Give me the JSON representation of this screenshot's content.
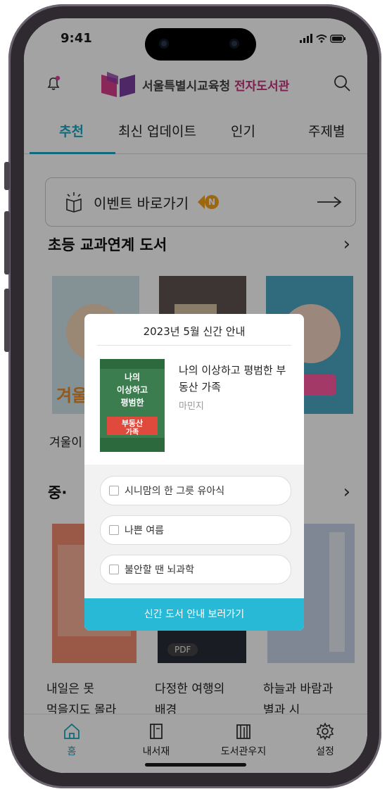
{
  "status": {
    "time": "9:41"
  },
  "header": {
    "title_main": "서울특별시교육청 ",
    "title_accent": "전자도서관"
  },
  "tabs": [
    {
      "label": "추천",
      "active": true
    },
    {
      "label": "최신 업데이트",
      "active": false
    },
    {
      "label": "인기",
      "active": false
    },
    {
      "label": "주제별",
      "active": false
    }
  ],
  "event": {
    "label": "이벤트 바로가기",
    "badge": "N"
  },
  "sections": {
    "elementary": "초등 교과연계 도서",
    "middle": "중·"
  },
  "books_row1": [
    {
      "caption": "겨울이"
    }
  ],
  "books_row2": [
    {
      "caption_line1": "내일은 못",
      "caption_line2": "먹을지도 몰라"
    },
    {
      "caption_line1": "다정한 여행의",
      "caption_line2": "배경",
      "badge": "PDF"
    },
    {
      "caption_line1": "하늘과 바람과",
      "caption_line2": "별과 시"
    }
  ],
  "modal": {
    "title": "2023년 5월 신간 안내",
    "featured": {
      "title": "나의 이상하고 평범한 부동산 가족",
      "author": "마민지",
      "cover_text_1": "나의",
      "cover_text_2": "이상하고",
      "cover_text_3": "평범한",
      "cover_text_4": "부동산",
      "cover_text_5": "가족"
    },
    "items": [
      "시니맘의 한 그릇 유아식",
      "나쁜 여름",
      "불안할 땐 뇌과학"
    ],
    "cta": "신간 도서 안내 보러가기"
  },
  "nav": [
    {
      "label": "홈",
      "icon": "home-icon",
      "active": true
    },
    {
      "label": "내서재",
      "icon": "book-icon",
      "active": false
    },
    {
      "label": "도서관우지",
      "icon": "library-icon",
      "active": false
    },
    {
      "label": "설정",
      "icon": "gear-icon",
      "active": false
    }
  ],
  "colors": {
    "accent": "#1aa6c2",
    "brand_pink": "#c2307a",
    "cta": "#27b9d6",
    "badge": "#f2a21c"
  }
}
